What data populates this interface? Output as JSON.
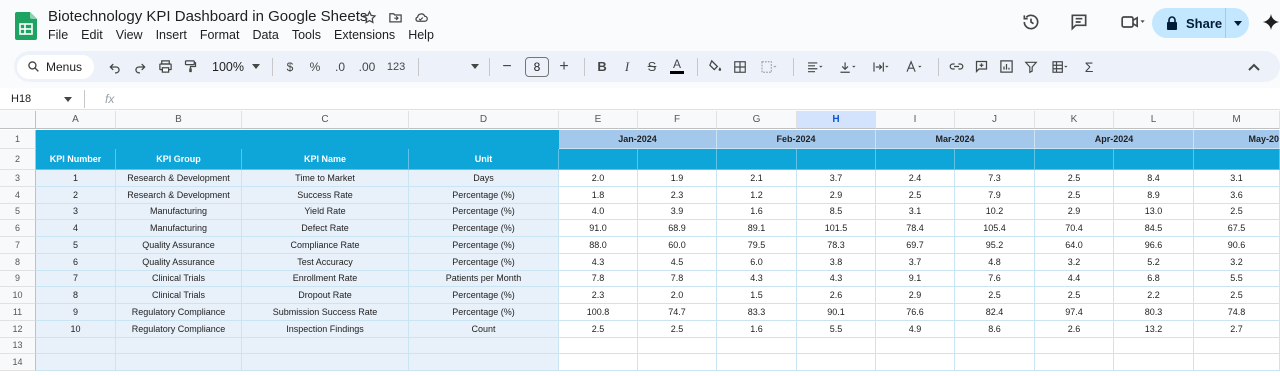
{
  "app": {
    "doc_title": "Biotechnology KPI Dashboard in Google Sheets",
    "menu": [
      "File",
      "Edit",
      "View",
      "Insert",
      "Format",
      "Data",
      "Tools",
      "Extensions",
      "Help"
    ],
    "share_label": "Share"
  },
  "toolbar": {
    "menus_label": "Menus",
    "zoom": "100%",
    "currency": "$",
    "percent": "%",
    "dec_decrease": ".0",
    "dec_increase": ".00",
    "number_format": "123",
    "font_size": "8"
  },
  "formula_bar": {
    "cell_ref": "H18",
    "fx": "fx",
    "content": ""
  },
  "colors": {
    "header_blue": "#0ea5d9",
    "month_band": "#a4c8eb",
    "frozen_fill": "#e8f0f9",
    "selection": "#d3e3fd"
  },
  "sheet": {
    "column_letters": [
      "A",
      "B",
      "C",
      "D",
      "E",
      "F",
      "G",
      "H",
      "I",
      "J",
      "K",
      "L",
      "M"
    ],
    "row_numbers": [
      "1",
      "2",
      "3",
      "4",
      "5",
      "6",
      "7",
      "8",
      "9",
      "10",
      "11",
      "12",
      "13",
      "14"
    ],
    "months": [
      "Jan-2024",
      "Feb-2024",
      "Mar-2024",
      "Apr-2024",
      "May-20"
    ],
    "headers": [
      "KPI Number",
      "KPI Group",
      "KPI Name",
      "Unit"
    ],
    "rows": [
      {
        "num": "1",
        "group": "Research & Development",
        "name": "Time to Market",
        "unit": "Days",
        "vals": [
          "2.0",
          "1.9",
          "2.1",
          "3.7",
          "2.4",
          "7.3",
          "2.5",
          "8.4",
          "3.1"
        ]
      },
      {
        "num": "2",
        "group": "Research & Development",
        "name": "Success Rate",
        "unit": "Percentage (%)",
        "vals": [
          "1.8",
          "2.3",
          "1.2",
          "2.9",
          "2.5",
          "7.9",
          "2.5",
          "8.9",
          "3.6"
        ]
      },
      {
        "num": "3",
        "group": "Manufacturing",
        "name": "Yield Rate",
        "unit": "Percentage (%)",
        "vals": [
          "4.0",
          "3.9",
          "1.6",
          "8.5",
          "3.1",
          "10.2",
          "2.9",
          "13.0",
          "2.5"
        ]
      },
      {
        "num": "4",
        "group": "Manufacturing",
        "name": "Defect Rate",
        "unit": "Percentage (%)",
        "vals": [
          "91.0",
          "68.9",
          "89.1",
          "101.5",
          "78.4",
          "105.4",
          "70.4",
          "84.5",
          "67.5"
        ]
      },
      {
        "num": "5",
        "group": "Quality Assurance",
        "name": "Compliance Rate",
        "unit": "Percentage (%)",
        "vals": [
          "88.0",
          "60.0",
          "79.5",
          "78.3",
          "69.7",
          "95.2",
          "64.0",
          "96.6",
          "90.6"
        ]
      },
      {
        "num": "6",
        "group": "Quality Assurance",
        "name": "Test Accuracy",
        "unit": "Percentage (%)",
        "vals": [
          "4.3",
          "4.5",
          "6.0",
          "3.8",
          "3.7",
          "4.8",
          "3.2",
          "5.2",
          "3.2"
        ]
      },
      {
        "num": "7",
        "group": "Clinical Trials",
        "name": "Enrollment Rate",
        "unit": "Patients per Month",
        "vals": [
          "7.8",
          "7.8",
          "4.3",
          "4.3",
          "9.1",
          "7.6",
          "4.4",
          "6.8",
          "5.5"
        ]
      },
      {
        "num": "8",
        "group": "Clinical Trials",
        "name": "Dropout Rate",
        "unit": "Percentage (%)",
        "vals": [
          "2.3",
          "2.0",
          "1.5",
          "2.6",
          "2.9",
          "2.5",
          "2.5",
          "2.2",
          "2.5"
        ]
      },
      {
        "num": "9",
        "group": "Regulatory Compliance",
        "name": "Submission Success Rate",
        "unit": "Percentage (%)",
        "vals": [
          "100.8",
          "74.7",
          "83.3",
          "90.1",
          "76.6",
          "82.4",
          "97.4",
          "80.3",
          "74.8"
        ]
      },
      {
        "num": "10",
        "group": "Regulatory Compliance",
        "name": "Inspection Findings",
        "unit": "Count",
        "vals": [
          "2.5",
          "2.5",
          "1.6",
          "5.5",
          "4.9",
          "8.6",
          "2.6",
          "13.2",
          "2.7"
        ]
      }
    ]
  }
}
